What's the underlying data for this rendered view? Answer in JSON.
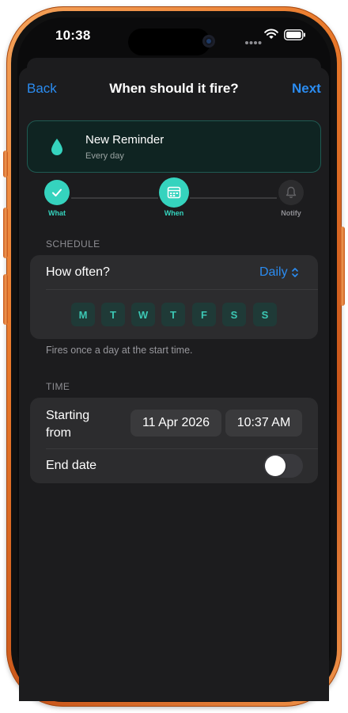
{
  "status_bar": {
    "time": "10:38"
  },
  "nav": {
    "back_label": "Back",
    "title": "When should it fire?",
    "next_label": "Next"
  },
  "reminder": {
    "title": "New Reminder",
    "subtitle": "Every day",
    "icon": "water-drop-icon"
  },
  "stepper": {
    "steps": [
      {
        "label": "What",
        "state": "done",
        "icon": "checkmark-icon"
      },
      {
        "label": "When",
        "state": "current",
        "icon": "calendar-icon"
      },
      {
        "label": "Notify",
        "state": "pending",
        "icon": "bell-icon"
      }
    ]
  },
  "schedule": {
    "header": "SCHEDULE",
    "frequency_label": "How often?",
    "frequency_value": "Daily",
    "days": [
      "M",
      "T",
      "W",
      "T",
      "F",
      "S",
      "S"
    ],
    "footnote": "Fires once a day at the start time."
  },
  "time": {
    "header": "TIME",
    "starting_label_line1": "Starting",
    "starting_label_line2": "from",
    "date_value": "11 Apr 2026",
    "time_value": "10:37 AM",
    "end_date_label": "End date",
    "end_date_enabled": false
  },
  "colors": {
    "accent_teal": "#35d3be",
    "link_blue": "#2b8cf1",
    "frame_orange": "#e8782a"
  }
}
